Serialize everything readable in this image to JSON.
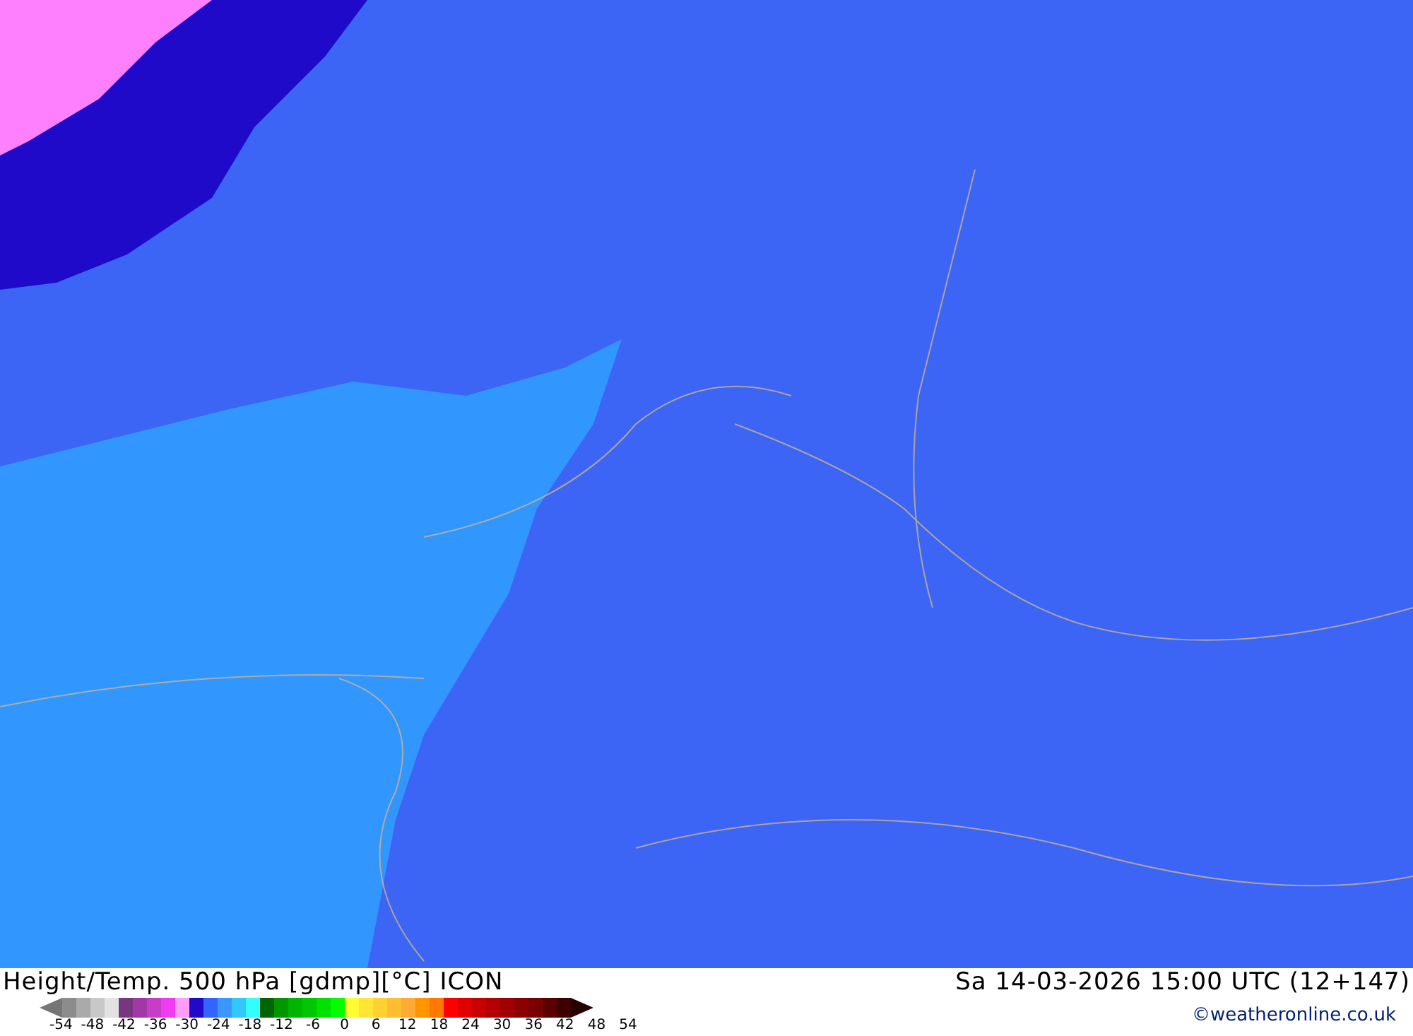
{
  "map": {
    "title": "Height/Temp. 500 hPa [gdmp][°C] ICON",
    "valid_time": "Sa 14-03-2026 15:00 UTC (12+147)"
  },
  "legend": {
    "swatches": [
      {
        "color": "#8c8c8c"
      },
      {
        "color": "#aaaaaa"
      },
      {
        "color": "#c8c8c8"
      },
      {
        "color": "#e2e2e2"
      },
      {
        "color": "#7a3580"
      },
      {
        "color": "#a238a8"
      },
      {
        "color": "#c83cc8"
      },
      {
        "color": "#f03cf0"
      },
      {
        "color": "#ff9cff"
      },
      {
        "color": "#1e0ac8"
      },
      {
        "color": "#3264ff"
      },
      {
        "color": "#3c96ff"
      },
      {
        "color": "#32c8ff"
      },
      {
        "color": "#32ffff"
      },
      {
        "color": "#006400"
      },
      {
        "color": "#009600"
      },
      {
        "color": "#00b400"
      },
      {
        "color": "#00c800"
      },
      {
        "color": "#00e100"
      },
      {
        "color": "#00ff00"
      },
      {
        "color": "#ffff32"
      },
      {
        "color": "#ffe632"
      },
      {
        "color": "#ffd232"
      },
      {
        "color": "#ffbe32"
      },
      {
        "color": "#ffaa32"
      },
      {
        "color": "#ff9600"
      },
      {
        "color": "#ff7800"
      },
      {
        "color": "#ff0000"
      },
      {
        "color": "#e10000"
      },
      {
        "color": "#c80000"
      },
      {
        "color": "#b40000"
      },
      {
        "color": "#a00000"
      },
      {
        "color": "#8c0000"
      },
      {
        "color": "#780000"
      },
      {
        "color": "#5a0000"
      },
      {
        "color": "#3c0000"
      }
    ],
    "ticks": [
      "-54",
      "-48",
      "-42",
      "-36",
      "-30",
      "-24",
      "-18",
      "-12",
      "-6",
      "0",
      "6",
      "12",
      "18",
      "24",
      "30",
      "36",
      "42",
      "48",
      "54"
    ]
  },
  "copyright": "©weatheronline.co.uk"
}
